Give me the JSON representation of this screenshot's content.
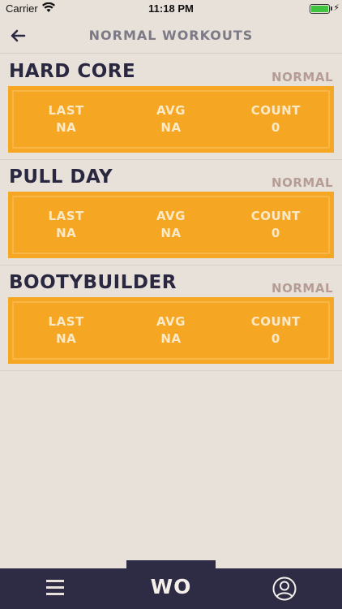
{
  "status_bar": {
    "carrier": "Carrier",
    "time": "11:18 PM",
    "battery_level": 1.0
  },
  "nav": {
    "title": "NORMAL WORKOUTS",
    "back_icon": "arrow-left-icon"
  },
  "workouts": [
    {
      "name": "HARD CORE",
      "type": "NORMAL",
      "stats": [
        {
          "label": "LAST",
          "value": "NA"
        },
        {
          "label": "AVG",
          "value": "NA"
        },
        {
          "label": "COUNT",
          "value": "0"
        }
      ]
    },
    {
      "name": "PULL DAY",
      "type": "NORMAL",
      "stats": [
        {
          "label": "LAST",
          "value": "NA"
        },
        {
          "label": "AVG",
          "value": "NA"
        },
        {
          "label": "COUNT",
          "value": "0"
        }
      ]
    },
    {
      "name": "BOOTYBUILDER",
      "type": "NORMAL",
      "stats": [
        {
          "label": "LAST",
          "value": "NA"
        },
        {
          "label": "AVG",
          "value": "NA"
        },
        {
          "label": "COUNT",
          "value": "0"
        }
      ]
    }
  ],
  "tab_bar": {
    "menu_icon": "hamburger-menu-icon",
    "center_label": "WO",
    "profile_icon": "user-profile-icon"
  },
  "colors": {
    "background": "#e8e1da",
    "accent": "#f5a623",
    "dark": "#2e2b44",
    "title_text": "#2a2840",
    "type_text": "#b59d96"
  }
}
